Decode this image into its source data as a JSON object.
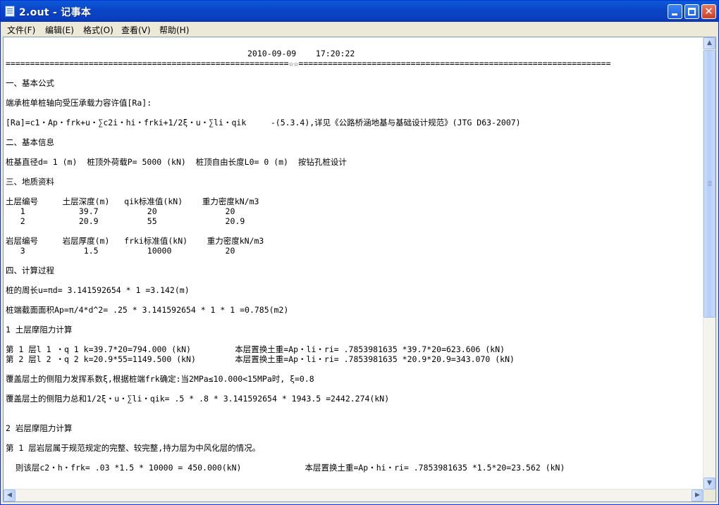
{
  "window": {
    "title": "2.out - 记事本"
  },
  "menu": [
    "文件(F)",
    "编辑(E)",
    "格式(O)",
    "查看(V)",
    "帮助(H)"
  ],
  "text": {
    "datetime": "2010-09-09    17:20:22",
    "separator": "==========================================================☆☆================================================================",
    "s1": "一、基本公式",
    "formula_title": "端承桩单桩轴向受压承载力容许值[Ra]:",
    "formula": "[Ra]=c1・Ap・frk+u・∑c2i・hi・frki+1/2ξ・u・∑li・qik     -(5.3.4),详见《公路桥涵地基与基础设计规范》(JTG D63-2007)",
    "s2": "二、基本信息",
    "basic": "桩基直径d= 1 (m)  桩顶外荷载P= 5000 (kN)  桩顶自由长度L0= 0 (m)  按钻孔桩设计",
    "s3": "三、地质资料",
    "soil_header": "土层编号     土层深度(m)   qik标准值(kN)    重力密度kN/m3",
    "soil_row1": "   1           39.7          20              20",
    "soil_row2": "   2           20.9          55              20.9",
    "rock_header": "岩层编号     岩层厚度(m)   frki标准值(kN)    重力密度kN/m3",
    "rock_row1": "   3            1.5          10000           20",
    "s4": "四、计算过程",
    "perimeter": "桩的周长u=πd= 3.141592654 * 1 =3.142(m)",
    "area": "桩端截面面积Ap=π/4*d^2= .25 * 3.141592654 * 1 * 1 =0.785(m2)",
    "soil_title": "1 土层摩阻力计算",
    "layer1": "第 1 层l 1 ・q 1 k=39.7*20=794.000 (kN)         本层置换土重=Ap・li・ri= .7853981635 *39.7*20=623.606 (kN)",
    "layer2": "第 2 层l 2 ・q 2 k=20.9*55=1149.500 (kN)        本层置换土重=Ap・li・ri= .7853981635 *20.9*20.9=343.070 (kN)",
    "coef": "覆盖层土的侧阻力发挥系数ξ,根据桩端frk确定:当2MPa≤10.000<15MPa时, ξ=0.8",
    "total": "覆盖层土的侧阻力总和1/2ξ・u・∑li・qik= .5 * .8 * 3.141592654 * 1943.5 =2442.274(kN)",
    "rock_title": "2 岩层摩阻力计算",
    "rock_desc": "第 1 层岩层属于规范规定的完整、较完整,持力层为中风化层的情况。",
    "rock_calc": "  则该层c2・h・frk= .03 *1.5 * 10000 = 450.000(kN)             本层置换土重=Ap・hi・ri= .7853981635 *1.5*20=23.562 (kN)"
  }
}
